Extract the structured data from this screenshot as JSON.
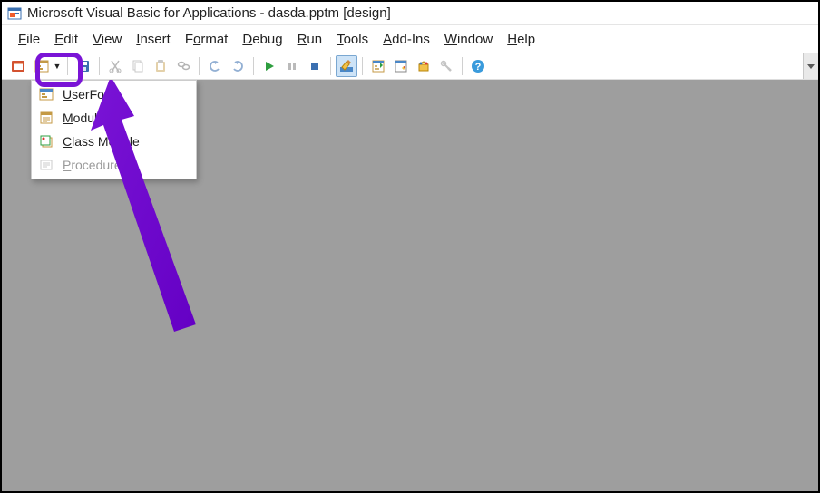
{
  "title": "Microsoft Visual Basic for Applications - dasda.pptm [design]",
  "menus": {
    "file": {
      "mn": "F",
      "rest": "ile"
    },
    "edit": {
      "mn": "E",
      "rest": "dit"
    },
    "view": {
      "mn": "V",
      "rest": "iew"
    },
    "insert": {
      "mn": "I",
      "rest": "nsert"
    },
    "format": {
      "mn": "o",
      "pre": "F",
      "rest": "rmat"
    },
    "debug": {
      "mn": "D",
      "rest": "ebug"
    },
    "run": {
      "mn": "R",
      "rest": "un"
    },
    "tools": {
      "mn": "T",
      "rest": "ools"
    },
    "addins": {
      "mn": "A",
      "rest": "dd-Ins"
    },
    "window": {
      "mn": "W",
      "rest": "indow"
    },
    "help": {
      "mn": "H",
      "rest": "elp"
    }
  },
  "dropdown": {
    "userform": {
      "mn": "U",
      "rest": "serForm"
    },
    "module": {
      "mn": "M",
      "rest": "odule"
    },
    "classmodule": {
      "mn": "C",
      "rest": "lass Module"
    },
    "procedure": {
      "mn": "P",
      "rest": "rocedure...",
      "disabled": true
    }
  },
  "colors": {
    "highlight": "#7a14d6",
    "workspace": "#9e9e9e"
  },
  "toolbar_buttons": [
    "view-powerpoint",
    "insert-userform-dropdown",
    "sep",
    "save",
    "sep",
    "cut",
    "copy",
    "paste",
    "find",
    "sep",
    "undo",
    "redo",
    "sep",
    "run",
    "break",
    "reset",
    "sep",
    "design-mode",
    "sep",
    "project-explorer",
    "properties-window",
    "object-browser",
    "toolbox",
    "sep",
    "help"
  ]
}
